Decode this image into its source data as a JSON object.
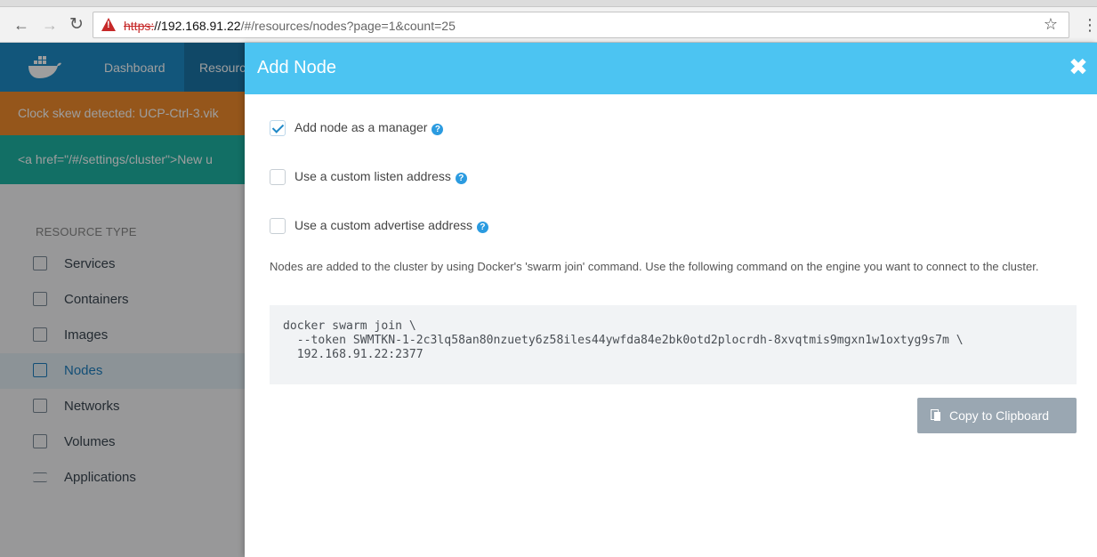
{
  "browser": {
    "url_scheme": "https:",
    "url_host": "//192.168.91.22",
    "url_path": "/#/resources/nodes?page=1&count=25",
    "back_icon": "arrow-left-icon",
    "forward_icon": "arrow-right-icon",
    "reload_icon": "reload-icon",
    "star_icon": "star-icon",
    "menu_icon": "kebab-menu-icon"
  },
  "app": {
    "nav": {
      "dashboard_label": "Dashboard",
      "resources_label": "Resourc"
    },
    "warning_banner": "Clock skew detected: UCP-Ctrl-3.vik",
    "info_banner": "<a href=\"/#/settings/cluster\">New u",
    "sidebar": {
      "heading": "RESOURCE TYPE",
      "items": [
        {
          "label": "Services",
          "icon": "services-icon"
        },
        {
          "label": "Containers",
          "icon": "containers-icon"
        },
        {
          "label": "Images",
          "icon": "images-icon"
        },
        {
          "label": "Nodes",
          "icon": "nodes-icon",
          "active": true
        },
        {
          "label": "Networks",
          "icon": "networks-icon"
        },
        {
          "label": "Volumes",
          "icon": "volumes-icon"
        },
        {
          "label": "Applications",
          "icon": "applications-icon"
        }
      ]
    }
  },
  "modal": {
    "title": "Add Node",
    "close_icon": "close-icon",
    "options": [
      {
        "label": "Add node as a manager",
        "checked": true
      },
      {
        "label": "Use a custom listen address",
        "checked": false
      },
      {
        "label": "Use a custom advertise address",
        "checked": false
      }
    ],
    "description": "Nodes are added to the cluster by using Docker's 'swarm join' command. Use the following command on the engine you want to connect to the cluster.",
    "command_lines": [
      "docker swarm join \\",
      "  --token SWMTKN-1-2c3lq58an80nzuety6z58iles44ywfda84e2bk0otd2plocrdh-8xvqtmis9mgxn1w1oxtyg9s7m \\",
      "  192.168.91.22:2377"
    ],
    "copy_button_label": "Copy to Clipboard"
  },
  "colors": {
    "modal_header": "#4cc4f2",
    "app_nav": "#1d8cc7",
    "warning_banner": "#f08c2d",
    "info_banner": "#1eb3a4",
    "copy_button": "#9aa7b2"
  }
}
